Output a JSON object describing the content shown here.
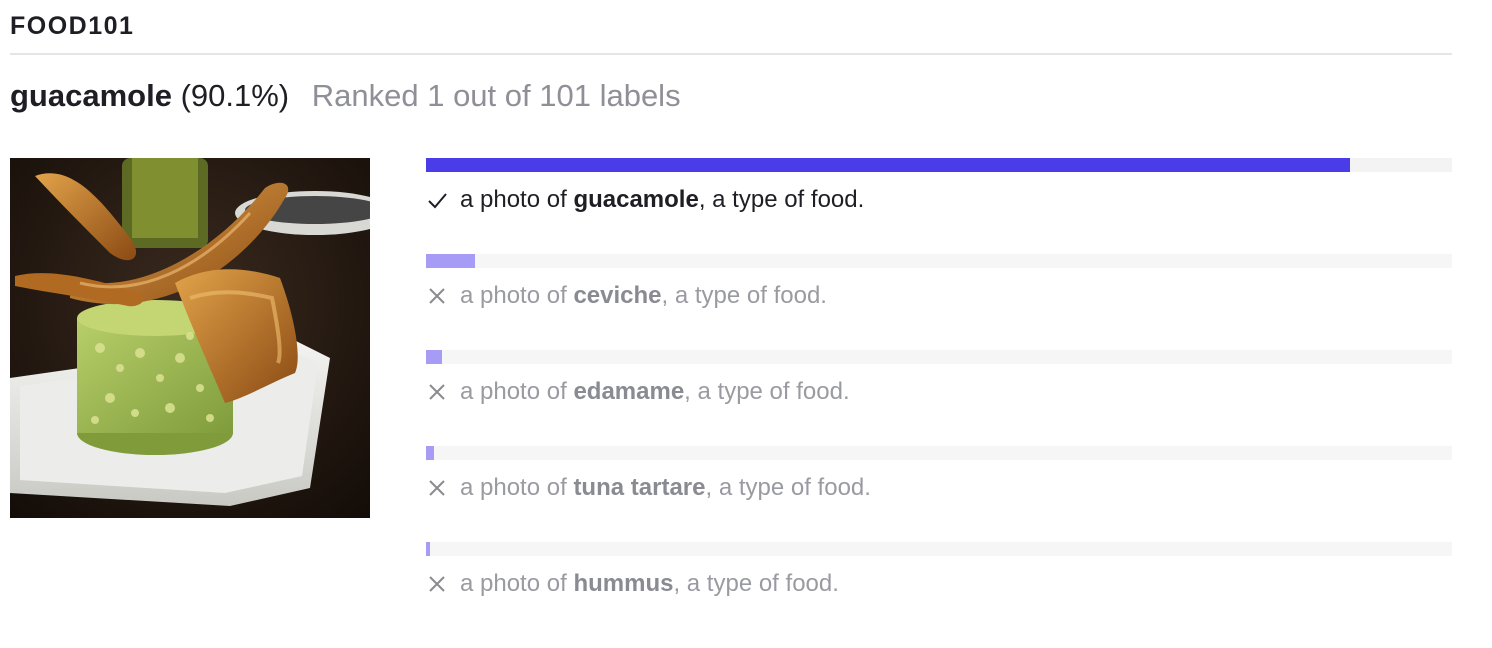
{
  "dataset": {
    "title": "FOOD101"
  },
  "result": {
    "label": "guacamole",
    "percent": "(90.1%)",
    "rank_text": "Ranked 1 out of 101 labels"
  },
  "image": {
    "icon": "food-photo-guacamole"
  },
  "colors": {
    "correct_bar": "#4a3de8",
    "other_bar": "#a79cf5",
    "track": "#f3f3f3",
    "correct_text": "#1e1e24",
    "other_text": "#9a9aa2"
  },
  "predictions": [
    {
      "prefix": "a photo of ",
      "label": "guacamole",
      "suffix": ", a type of food.",
      "score": 0.901,
      "correct": true,
      "icon": "check-icon"
    },
    {
      "prefix": "a photo of ",
      "label": "ceviche",
      "suffix": ", a type of food.",
      "score": 0.048,
      "correct": false,
      "icon": "close-icon"
    },
    {
      "prefix": "a photo of ",
      "label": "edamame",
      "suffix": ", a type of food.",
      "score": 0.016,
      "correct": false,
      "icon": "close-icon"
    },
    {
      "prefix": "a photo of ",
      "label": "tuna tartare",
      "suffix": ", a type of food.",
      "score": 0.008,
      "correct": false,
      "icon": "close-icon"
    },
    {
      "prefix": "a photo of ",
      "label": "hummus",
      "suffix": ", a type of food.",
      "score": 0.004,
      "correct": false,
      "icon": "close-icon"
    }
  ]
}
